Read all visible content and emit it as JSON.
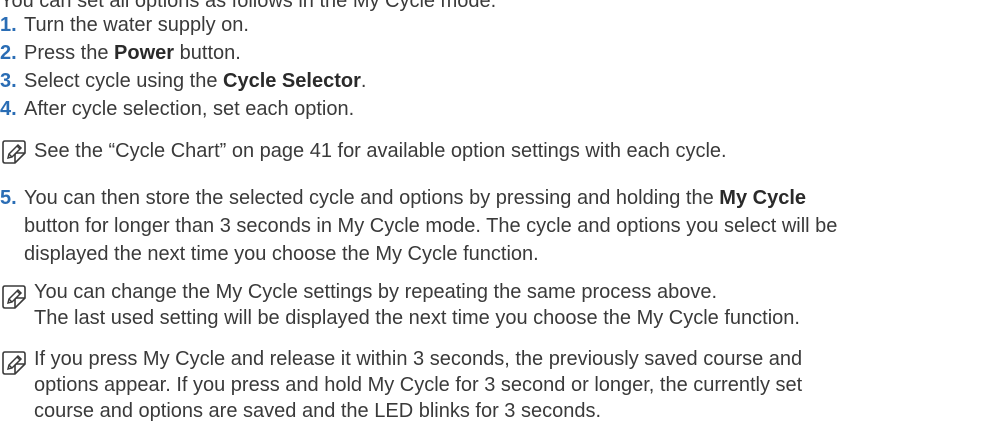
{
  "intro": "You can set all options as follows in the My Cycle mode.",
  "steps": [
    {
      "num": "1.",
      "text": "Turn the water supply on."
    },
    {
      "num": "2.",
      "pre": "Press the ",
      "bold": "Power",
      "post": " button."
    },
    {
      "num": "3.",
      "pre": "Select cycle using the ",
      "bold": "Cycle Selector",
      "post": "."
    },
    {
      "num": "4.",
      "text": "After cycle selection, set each option."
    },
    {
      "num": "5.",
      "pre": "You can then store the selected cycle and options by pressing and holding the ",
      "bold": "My Cycle",
      "line2": "button for longer than 3 seconds in My Cycle mode. The cycle and options you select will be",
      "line3": "displayed the next time you choose the My Cycle function."
    }
  ],
  "notes": [
    {
      "line1": "See the “Cycle Chart” on page 41 for available option settings with each cycle."
    },
    {
      "line1": "You can change the My Cycle settings by repeating the same process above.",
      "line2": "The last used setting will be displayed the next time you choose the My Cycle function."
    },
    {
      "line1": "If you press My Cycle and release it within 3 seconds, the previously saved course and",
      "line2": "options appear. If you press and hold My Cycle for 3 second or longer, the currently set",
      "line3": "course and options are saved and the LED blinks for 3 seconds."
    }
  ],
  "icons": {
    "note": "note-pencil-icon"
  },
  "colors": {
    "step_number": "#2a6db5",
    "text": "#3a3a3a"
  }
}
